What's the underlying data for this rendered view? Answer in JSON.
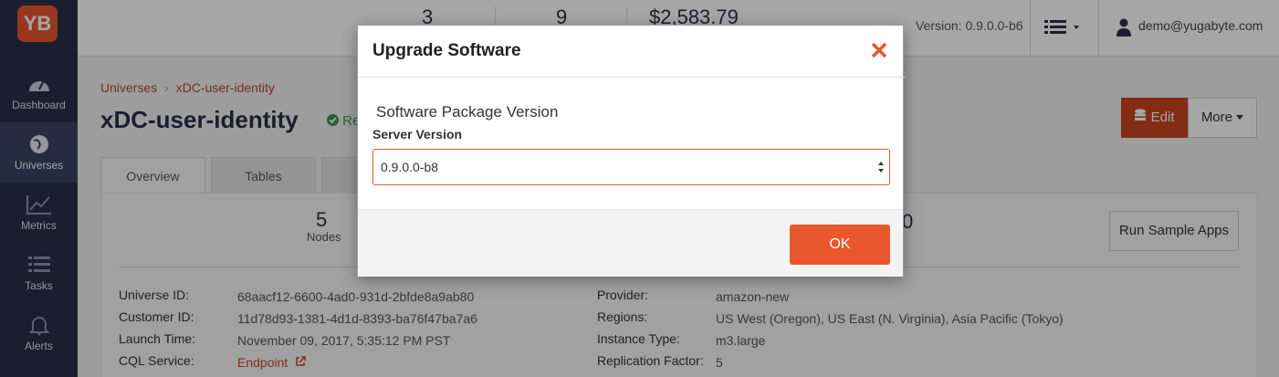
{
  "logo_text": "YB",
  "sidebar": {
    "items": [
      {
        "label": "Dashboard"
      },
      {
        "label": "Universes"
      },
      {
        "label": "Metrics"
      },
      {
        "label": "Tasks"
      },
      {
        "label": "Alerts"
      }
    ]
  },
  "topbar": {
    "stats": [
      "3",
      "9",
      "$2,583.79"
    ],
    "version": "Version: 0.9.0.0-b6",
    "user": "demo@yugabyte.com"
  },
  "main": {
    "breadcrumb_root": "Universes",
    "breadcrumb_sep": "›",
    "breadcrumb_current": "xDC-user-identity",
    "title": "xDC-user-identity",
    "status": "Re",
    "edit_label": "Edit",
    "more_label": "More",
    "tabs": [
      {
        "label": "Overview"
      },
      {
        "label": "Tables"
      },
      {
        "label": ""
      }
    ],
    "nodes_count": "5",
    "nodes_label": "Nodes",
    "right_stat": "0",
    "run_sample_label": "Run Sample Apps",
    "info_left": [
      {
        "label": "Universe ID:",
        "value": "68aacf12-6600-4ad0-931d-2bfde8a9ab80"
      },
      {
        "label": "Customer ID:",
        "value": "11d78d93-1381-4d1d-8393-ba76f47ba7a6"
      },
      {
        "label": "Launch Time:",
        "value": "November 09, 2017, 5:35:12 PM PST"
      },
      {
        "label": "CQL Service:",
        "value": "Endpoint"
      }
    ],
    "info_right": [
      {
        "label": "Provider:",
        "value": "amazon-new"
      },
      {
        "label": "Regions:",
        "value": "US West (Oregon), US East (N. Virginia), Asia Pacific (Tokyo)"
      },
      {
        "label": "Instance Type:",
        "value": "m3.large"
      },
      {
        "label": "Replication Factor:",
        "value": "5"
      }
    ]
  },
  "modal": {
    "title": "Upgrade Software",
    "section_title": "Software Package Version",
    "field_label": "Server Version",
    "selected_version": "0.9.0.0-b8",
    "ok_label": "OK"
  },
  "colors": {
    "accent": "#e8572e",
    "sidebar_bg": "#2b2f4a",
    "status_green": "#3a9b50"
  }
}
